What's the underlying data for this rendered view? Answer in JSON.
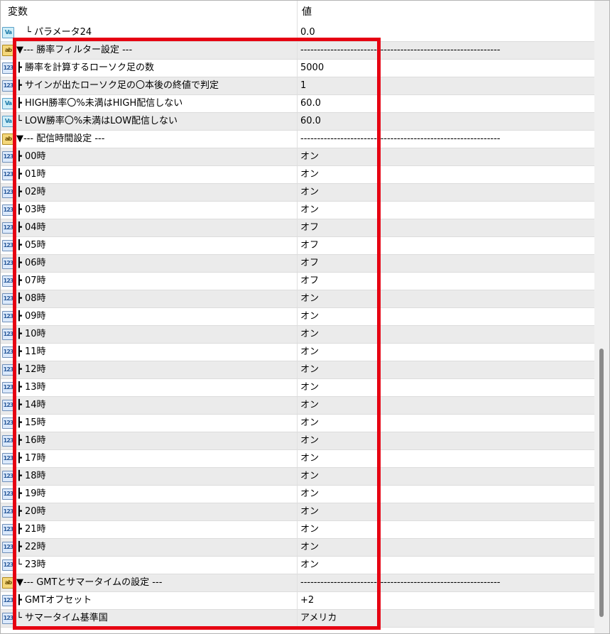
{
  "header": {
    "name": "変数",
    "value": "値"
  },
  "rows": [
    {
      "icon": "dbl",
      "icon_text": "Va",
      "name": "　└ パラメータ24",
      "value": "0.0"
    },
    {
      "icon": "str",
      "icon_text": "ab",
      "name": "▼--- 勝率フィルター設定 ---",
      "value": "------------------------------------------------------------"
    },
    {
      "icon": "num",
      "icon_text": "123",
      "name": "┣ 勝率を計算するローソク足の数",
      "value": "5000"
    },
    {
      "icon": "num",
      "icon_text": "123",
      "name": "┣ サインが出たローソク足の〇本後の終値で判定",
      "value": "1"
    },
    {
      "icon": "dbl",
      "icon_text": "Va",
      "name": "┣ HIGH勝率〇%未満はHIGH配信しない",
      "value": "60.0"
    },
    {
      "icon": "dbl",
      "icon_text": "Va",
      "name": "└ LOW勝率〇%未満はLOW配信しない",
      "value": "60.0"
    },
    {
      "icon": "str",
      "icon_text": "ab",
      "name": "▼--- 配信時間設定 ---",
      "value": "------------------------------------------------------------"
    },
    {
      "icon": "num",
      "icon_text": "123",
      "name": "┣ 00時",
      "value": "オン"
    },
    {
      "icon": "num",
      "icon_text": "123",
      "name": "┣ 01時",
      "value": "オン"
    },
    {
      "icon": "num",
      "icon_text": "123",
      "name": "┣ 02時",
      "value": "オン"
    },
    {
      "icon": "num",
      "icon_text": "123",
      "name": "┣ 03時",
      "value": "オン"
    },
    {
      "icon": "num",
      "icon_text": "123",
      "name": "┣ 04時",
      "value": "オフ"
    },
    {
      "icon": "num",
      "icon_text": "123",
      "name": "┣ 05時",
      "value": "オフ"
    },
    {
      "icon": "num",
      "icon_text": "123",
      "name": "┣ 06時",
      "value": "オフ"
    },
    {
      "icon": "num",
      "icon_text": "123",
      "name": "┣ 07時",
      "value": "オフ"
    },
    {
      "icon": "num",
      "icon_text": "123",
      "name": "┣ 08時",
      "value": "オン"
    },
    {
      "icon": "num",
      "icon_text": "123",
      "name": "┣ 09時",
      "value": "オン"
    },
    {
      "icon": "num",
      "icon_text": "123",
      "name": "┣ 10時",
      "value": "オン"
    },
    {
      "icon": "num",
      "icon_text": "123",
      "name": "┣ 11時",
      "value": "オン"
    },
    {
      "icon": "num",
      "icon_text": "123",
      "name": "┣ 12時",
      "value": "オン"
    },
    {
      "icon": "num",
      "icon_text": "123",
      "name": "┣ 13時",
      "value": "オン"
    },
    {
      "icon": "num",
      "icon_text": "123",
      "name": "┣ 14時",
      "value": "オン"
    },
    {
      "icon": "num",
      "icon_text": "123",
      "name": "┣ 15時",
      "value": "オン"
    },
    {
      "icon": "num",
      "icon_text": "123",
      "name": "┣ 16時",
      "value": "オン"
    },
    {
      "icon": "num",
      "icon_text": "123",
      "name": "┣ 17時",
      "value": "オン"
    },
    {
      "icon": "num",
      "icon_text": "123",
      "name": "┣ 18時",
      "value": "オン"
    },
    {
      "icon": "num",
      "icon_text": "123",
      "name": "┣ 19時",
      "value": "オン"
    },
    {
      "icon": "num",
      "icon_text": "123",
      "name": "┣ 20時",
      "value": "オン"
    },
    {
      "icon": "num",
      "icon_text": "123",
      "name": "┣ 21時",
      "value": "オン"
    },
    {
      "icon": "num",
      "icon_text": "123",
      "name": "┣ 22時",
      "value": "オン"
    },
    {
      "icon": "num",
      "icon_text": "123",
      "name": "└ 23時",
      "value": "オン"
    },
    {
      "icon": "str",
      "icon_text": "ab",
      "name": "▼--- GMTとサマータイムの設定 ---",
      "value": "------------------------------------------------------------"
    },
    {
      "icon": "num",
      "icon_text": "123",
      "name": "┣ GMTオフセット",
      "value": "+2"
    },
    {
      "icon": "num",
      "icon_text": "123",
      "name": "└ サマータイム基準国",
      "value": "アメリカ"
    }
  ],
  "colors": {
    "highlight": "#e60012",
    "row_alt": "#ebebeb",
    "scroll_thumb": "#8a8a8a"
  }
}
